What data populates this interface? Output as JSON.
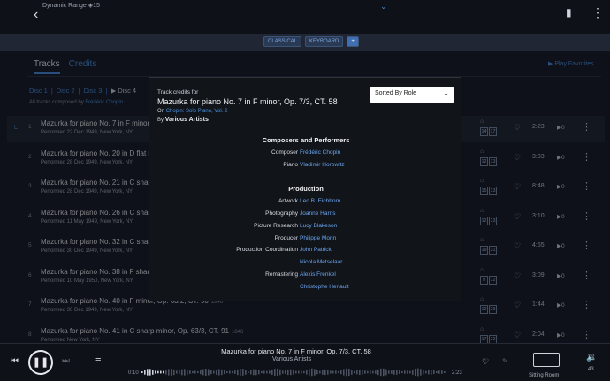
{
  "topbar": {
    "dynamic_range": "Dynamic Range  ◈15"
  },
  "tags": [
    "CLASSICAL",
    "KEYBOARD",
    "+"
  ],
  "tabs": {
    "tracks": "Tracks",
    "credits": "Credits",
    "play_favorites": "Play Favorites"
  },
  "discs": [
    "Disc 1",
    "Disc 2",
    "Disc 3"
  ],
  "disc_current": "Disc 4",
  "composed": {
    "prefix": "All tracks composed by",
    "composer": "Frédéric Chopin"
  },
  "tracks": [
    {
      "num": "1",
      "title": "Mazurka for piano No. 7 in F minor,",
      "year": "",
      "performed": "Performed 22 Dec 1949, New York, NY",
      "b1": "14",
      "b2": "17",
      "duration": "2:23",
      "plays": "0"
    },
    {
      "num": "2",
      "title": "Mazurka for piano No. 20 in D flat m",
      "year": "",
      "performed": "Performed 28 Dec 1949, New York, NY",
      "b1": "12",
      "b2": "13",
      "duration": "3:03",
      "plays": "0"
    },
    {
      "num": "3",
      "title": "Mazurka for piano No. 21 in C sharp",
      "year": "",
      "performed": "Performed 28 Dec 1949, New York, NY",
      "b1": "15",
      "b2": "13",
      "duration": "8:48",
      "plays": "0"
    },
    {
      "num": "4",
      "title": "Mazurka for piano No. 26 in C sharp",
      "year": "",
      "performed": "Performed 11 May 1949, New York, NY",
      "b1": "12",
      "b2": "13",
      "duration": "3:10",
      "plays": "0"
    },
    {
      "num": "5",
      "title": "Mazurka for piano No. 32 in C sharp",
      "year": "",
      "performed": "Performed 30 Dec 1949, New York, NY",
      "b1": "19",
      "b2": "31",
      "duration": "4:55",
      "plays": "0"
    },
    {
      "num": "6",
      "title": "Mazurka for piano No. 38 in F sharp",
      "year": "",
      "performed": "Performed 10 May 1950, New York, NY",
      "b1": "9",
      "b2": "12",
      "duration": "3:09",
      "plays": "0"
    },
    {
      "num": "7",
      "title": "Mazurka for piano No. 40 in F minor, Op. 63/2, CT. 90",
      "year": "1846",
      "performed": "Performed 30 Dec 1949, New York, NY",
      "b1": "12",
      "b2": "23",
      "duration": "1:44",
      "plays": "0"
    },
    {
      "num": "8",
      "title": "Mazurka for piano No. 41 in C sharp minor, Op. 63/3, CT. 91",
      "year": "1846",
      "performed": "Performed New York, NY",
      "b1": "17",
      "b2": "12",
      "duration": "2:04",
      "plays": "0"
    }
  ],
  "modal": {
    "label": "Track credits for",
    "title": "Mazurka for piano No. 7 in F minor, Op. 7/3, CT. 58",
    "on_prefix": "On",
    "album": "Chopin: Solo Piano, Vol. 2",
    "by_prefix": "By",
    "artist": "Various Artists",
    "sort": "Sorted By Role",
    "sections": [
      {
        "title": "Composers and Performers",
        "credits": [
          {
            "role": "Composer",
            "name": "Frédéric Chopin"
          },
          {
            "role": "Piano",
            "name": "Vladimir Horowitz"
          }
        ]
      },
      {
        "title": "Production",
        "credits": [
          {
            "role": "Artwork",
            "name": "Leo B. Eichhorn"
          },
          {
            "role": "Photography",
            "name": "Joanne Harris"
          },
          {
            "role": "Picture Research",
            "name": "Lucy Blakeson"
          },
          {
            "role": "Producer",
            "name": "Philippe Morin"
          },
          {
            "role": "Production Coordination",
            "name": "John Patrick"
          },
          {
            "role": "",
            "name": "Nicola Metselaar"
          },
          {
            "role": "Remastering",
            "name": "Alexis Frenkel"
          },
          {
            "role": "",
            "name": "Christophe Henault"
          }
        ]
      }
    ]
  },
  "player": {
    "title": "Mazurka for piano No. 7 in F minor, Op. 7/3, CT. 58",
    "artist": "Various Artists",
    "elapsed": "0:10",
    "total": "2:23",
    "progress": 0.07,
    "room": "Sitting Room",
    "volume": "43"
  },
  "colors": {
    "accent": "#4a8fe0",
    "background": "#1a2030",
    "modal": "#111519"
  }
}
